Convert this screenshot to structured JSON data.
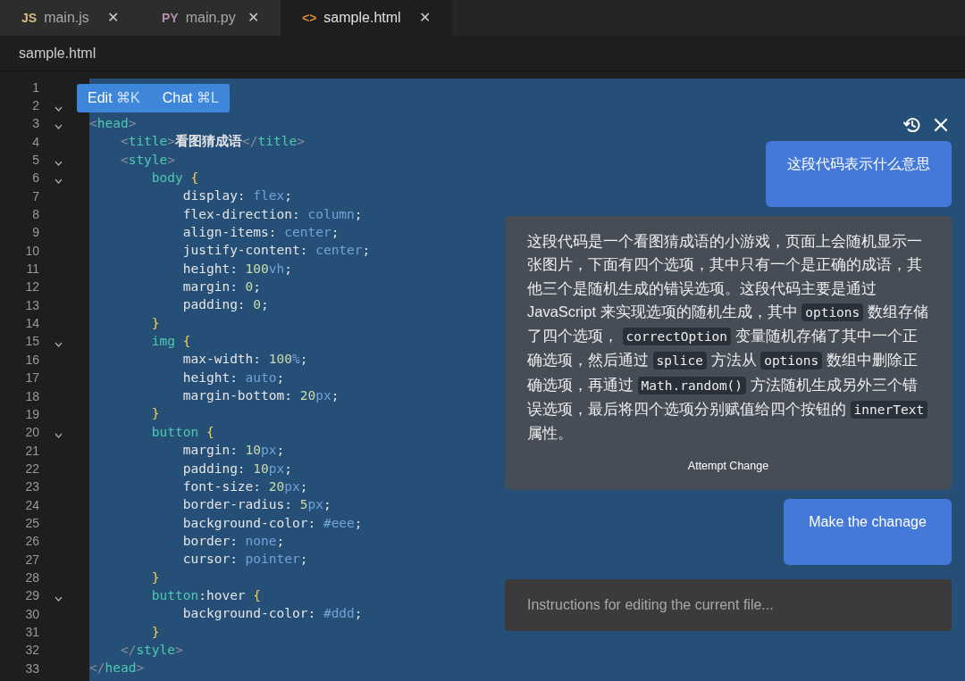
{
  "tabs": [
    {
      "kind": "js",
      "badge": "JS",
      "label": "main.js",
      "close": "✕",
      "selected": false
    },
    {
      "kind": "py",
      "badge": "PY",
      "label": "main.py",
      "close": "✕",
      "selected": false
    },
    {
      "kind": "html",
      "badge": "<>",
      "label": "sample.html",
      "close": "✕",
      "selected": true
    }
  ],
  "breadcrumb": "sample.html",
  "popup": [
    {
      "label": "Edit",
      "shortcut": "⌘K"
    },
    {
      "label": "Chat",
      "shortcut": "⌘L"
    }
  ],
  "lines": [
    {
      "number": "1",
      "foldable": false
    },
    {
      "number": "2",
      "foldable": true
    },
    {
      "number": "3",
      "foldable": true,
      "tokens": [
        {
          "kind": "punct",
          "text": "<"
        },
        {
          "kind": "tag",
          "text": "head"
        },
        {
          "kind": "punct",
          "text": ">"
        }
      ]
    },
    {
      "number": "4",
      "foldable": false,
      "tokens": [
        {
          "kind": "punct",
          "text": "    <"
        },
        {
          "kind": "tag",
          "text": "title"
        },
        {
          "kind": "punct",
          "text": ">"
        },
        {
          "kind": "plain",
          "text": "看图猜成语"
        },
        {
          "kind": "punct",
          "text": "</"
        },
        {
          "kind": "tag",
          "text": "title"
        },
        {
          "kind": "punct",
          "text": ">"
        }
      ]
    },
    {
      "number": "5",
      "foldable": true,
      "tokens": [
        {
          "kind": "punct",
          "text": "    <"
        },
        {
          "kind": "tag",
          "text": "style"
        },
        {
          "kind": "punct",
          "text": ">"
        }
      ]
    },
    {
      "number": "6",
      "foldable": true,
      "tokens": [
        {
          "kind": "tag",
          "text": "        body "
        },
        {
          "kind": "brace",
          "text": "{"
        }
      ]
    },
    {
      "number": "7",
      "foldable": false,
      "tokens": [
        {
          "kind": "plain",
          "text": "            display: "
        },
        {
          "kind": "value",
          "text": "flex"
        },
        {
          "kind": "plain",
          "text": ";"
        }
      ]
    },
    {
      "number": "8",
      "foldable": false,
      "tokens": [
        {
          "kind": "plain",
          "text": "            flex-direction: "
        },
        {
          "kind": "value",
          "text": "column"
        },
        {
          "kind": "plain",
          "text": ";"
        }
      ]
    },
    {
      "number": "9",
      "foldable": false,
      "tokens": [
        {
          "kind": "plain",
          "text": "            align-items: "
        },
        {
          "kind": "value",
          "text": "center"
        },
        {
          "kind": "plain",
          "text": ";"
        }
      ]
    },
    {
      "number": "10",
      "foldable": false,
      "tokens": [
        {
          "kind": "plain",
          "text": "            justify-content: "
        },
        {
          "kind": "value",
          "text": "center"
        },
        {
          "kind": "plain",
          "text": ";"
        }
      ]
    },
    {
      "number": "11",
      "foldable": false,
      "tokens": [
        {
          "kind": "plain",
          "text": "            height: "
        },
        {
          "kind": "number",
          "text": "100"
        },
        {
          "kind": "value",
          "text": "vh"
        },
        {
          "kind": "plain",
          "text": ";"
        }
      ]
    },
    {
      "number": "12",
      "foldable": false,
      "tokens": [
        {
          "kind": "plain",
          "text": "            margin: "
        },
        {
          "kind": "number",
          "text": "0"
        },
        {
          "kind": "plain",
          "text": ";"
        }
      ]
    },
    {
      "number": "13",
      "foldable": false,
      "tokens": [
        {
          "kind": "plain",
          "text": "            padding: "
        },
        {
          "kind": "number",
          "text": "0"
        },
        {
          "kind": "plain",
          "text": ";"
        }
      ]
    },
    {
      "number": "14",
      "foldable": false,
      "tokens": [
        {
          "kind": "brace",
          "text": "        }"
        }
      ]
    },
    {
      "number": "15",
      "foldable": true,
      "tokens": [
        {
          "kind": "tag",
          "text": "        img "
        },
        {
          "kind": "brace",
          "text": "{"
        }
      ]
    },
    {
      "number": "16",
      "foldable": false,
      "tokens": [
        {
          "kind": "plain",
          "text": "            max-width: "
        },
        {
          "kind": "number",
          "text": "100"
        },
        {
          "kind": "value",
          "text": "%"
        },
        {
          "kind": "plain",
          "text": ";"
        }
      ]
    },
    {
      "number": "17",
      "foldable": false,
      "tokens": [
        {
          "kind": "plain",
          "text": "            height: "
        },
        {
          "kind": "value",
          "text": "auto"
        },
        {
          "kind": "plain",
          "text": ";"
        }
      ]
    },
    {
      "number": "18",
      "foldable": false,
      "tokens": [
        {
          "kind": "plain",
          "text": "            margin-bottom: "
        },
        {
          "kind": "number",
          "text": "20"
        },
        {
          "kind": "value",
          "text": "px"
        },
        {
          "kind": "plain",
          "text": ";"
        }
      ]
    },
    {
      "number": "19",
      "foldable": false,
      "tokens": [
        {
          "kind": "brace",
          "text": "        }"
        }
      ]
    },
    {
      "number": "20",
      "foldable": true,
      "tokens": [
        {
          "kind": "tag",
          "text": "        button "
        },
        {
          "kind": "brace",
          "text": "{"
        }
      ]
    },
    {
      "number": "21",
      "foldable": false,
      "tokens": [
        {
          "kind": "plain",
          "text": "            margin: "
        },
        {
          "kind": "number",
          "text": "10"
        },
        {
          "kind": "value",
          "text": "px"
        },
        {
          "kind": "plain",
          "text": ";"
        }
      ]
    },
    {
      "number": "22",
      "foldable": false,
      "tokens": [
        {
          "kind": "plain",
          "text": "            padding: "
        },
        {
          "kind": "number",
          "text": "10"
        },
        {
          "kind": "value",
          "text": "px"
        },
        {
          "kind": "plain",
          "text": ";"
        }
      ]
    },
    {
      "number": "23",
      "foldable": false,
      "tokens": [
        {
          "kind": "plain",
          "text": "            font-size: "
        },
        {
          "kind": "number",
          "text": "20"
        },
        {
          "kind": "value",
          "text": "px"
        },
        {
          "kind": "plain",
          "text": ";"
        }
      ]
    },
    {
      "number": "24",
      "foldable": false,
      "tokens": [
        {
          "kind": "plain",
          "text": "            border-radius: "
        },
        {
          "kind": "number",
          "text": "5"
        },
        {
          "kind": "value",
          "text": "px"
        },
        {
          "kind": "plain",
          "text": ";"
        }
      ]
    },
    {
      "number": "25",
      "foldable": false,
      "tokens": [
        {
          "kind": "plain",
          "text": "            background-color: "
        },
        {
          "kind": "value",
          "text": "#eee"
        },
        {
          "kind": "plain",
          "text": ";"
        }
      ]
    },
    {
      "number": "26",
      "foldable": false,
      "tokens": [
        {
          "kind": "plain",
          "text": "            border: "
        },
        {
          "kind": "value",
          "text": "none"
        },
        {
          "kind": "plain",
          "text": ";"
        }
      ]
    },
    {
      "number": "27",
      "foldable": false,
      "tokens": [
        {
          "kind": "plain",
          "text": "            cursor: "
        },
        {
          "kind": "value",
          "text": "pointer"
        },
        {
          "kind": "plain",
          "text": ";"
        }
      ]
    },
    {
      "number": "28",
      "foldable": false,
      "tokens": [
        {
          "kind": "brace",
          "text": "        }"
        }
      ]
    },
    {
      "number": "29",
      "foldable": true,
      "tokens": [
        {
          "kind": "tag",
          "text": "        button"
        },
        {
          "kind": "plain",
          "text": ":hover "
        },
        {
          "kind": "brace",
          "text": "{"
        }
      ]
    },
    {
      "number": "30",
      "foldable": false,
      "tokens": [
        {
          "kind": "plain",
          "text": "            background-color: "
        },
        {
          "kind": "value",
          "text": "#ddd"
        },
        {
          "kind": "plain",
          "text": ";"
        }
      ]
    },
    {
      "number": "31",
      "foldable": false,
      "tokens": [
        {
          "kind": "brace",
          "text": "        }"
        }
      ]
    },
    {
      "number": "32",
      "foldable": false,
      "tokens": [
        {
          "kind": "punct",
          "text": "    </"
        },
        {
          "kind": "tag",
          "text": "style"
        },
        {
          "kind": "punct",
          "text": ">"
        }
      ]
    },
    {
      "number": "33",
      "foldable": false,
      "tokens": [
        {
          "kind": "punct",
          "text": "</"
        },
        {
          "kind": "tag",
          "text": "head"
        },
        {
          "kind": "punct",
          "text": ">"
        }
      ]
    }
  ],
  "chat": {
    "messages": [
      {
        "kind": "user",
        "segments": [
          {
            "kind": "text",
            "text": "这段代码表示什么意思"
          }
        ]
      },
      {
        "kind": "assistant",
        "segments": [
          {
            "kind": "text",
            "text": "这段代码是一个看图猜成语的小游戏，页面上会随机显示一张图片，下面有四个选项，其中只有一个是正确的成语，其他三个是随机生成的错误选项。这段代码主要是通过 JavaScript 来实现选项的随机生成，其中 "
          },
          {
            "kind": "code",
            "text": "options"
          },
          {
            "kind": "text",
            "text": " 数组存储了四个选项， "
          },
          {
            "kind": "code",
            "text": "correctOption"
          },
          {
            "kind": "text",
            "text": " 变量随机存储了其中一个正确选项，然后通过 "
          },
          {
            "kind": "code",
            "text": "splice"
          },
          {
            "kind": "text",
            "text": " 方法从 "
          },
          {
            "kind": "code",
            "text": "options"
          },
          {
            "kind": "text",
            "text": " 数组中删除正确选项，再通过 "
          },
          {
            "kind": "code",
            "text": "Math.random()"
          },
          {
            "kind": "text",
            "text": " 方法随机生成另外三个错误选项，最后将四个选项分别赋值给四个按钮的 "
          },
          {
            "kind": "code",
            "text": "innerText"
          },
          {
            "kind": "text",
            "text": " 属性。"
          }
        ],
        "action": "Attempt Change"
      },
      {
        "kind": "user",
        "segments": [
          {
            "kind": "text",
            "text": "Make the chanage"
          }
        ]
      }
    ],
    "input": {
      "placeholder": "Instructions for editing the current file..."
    }
  }
}
